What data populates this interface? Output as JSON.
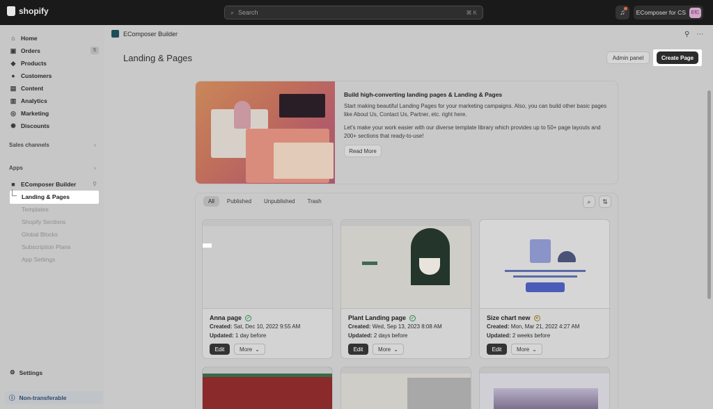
{
  "topbar": {
    "brand": "shopify",
    "search_placeholder": "Search",
    "search_shortcut": "⌘ K",
    "store_name": "EComposer for CS",
    "avatar_initials": "EfC"
  },
  "sidebar": {
    "items": [
      {
        "label": "Home",
        "icon": "home-icon"
      },
      {
        "label": "Orders",
        "icon": "orders-icon",
        "badge": "5"
      },
      {
        "label": "Products",
        "icon": "tag-icon"
      },
      {
        "label": "Customers",
        "icon": "person-icon"
      },
      {
        "label": "Content",
        "icon": "content-icon"
      },
      {
        "label": "Analytics",
        "icon": "chart-icon"
      },
      {
        "label": "Marketing",
        "icon": "target-icon"
      },
      {
        "label": "Discounts",
        "icon": "discount-icon"
      }
    ],
    "sales_channels": "Sales channels",
    "apps": "Apps",
    "app_name": "EComposer Builder",
    "app_subitems": [
      "Landing & Pages",
      "Templates",
      "Shopify Sections",
      "Global Blocks",
      "Subscription Plans",
      "App Settings"
    ],
    "settings": "Settings",
    "non_transferable": "Non-transferable"
  },
  "appbar": {
    "title": "EComposer Builder"
  },
  "page": {
    "title": "Landing & Pages",
    "admin_panel": "Admin panel",
    "create_page": "Create Page"
  },
  "banner": {
    "title": "Build high-converting landing pages & Landing & Pages",
    "text1": "Start making beautiful Landing Pages for your marketing campaigns. Also, you can build other basic pages like About Us, Contact Us, Partner, etc. right here.",
    "text2": "Let's make your work easier with our diverse template library which provides up to 50+ page layouts and 200+ sections that ready-to-use!",
    "read_more": "Read More"
  },
  "tabs": [
    "All",
    "Published",
    "Unpublished",
    "Trash"
  ],
  "cards": [
    {
      "title": "Anna page",
      "status": "published",
      "created_label": "Created:",
      "created": "Sat, Dec 10, 2022 9:55 AM",
      "updated_label": "Updated:",
      "updated": "1 day before",
      "edit": "Edit",
      "more": "More"
    },
    {
      "title": "Plant Landing page",
      "status": "published",
      "created_label": "Created:",
      "created": "Wed, Sep 13, 2023 8:08 AM",
      "updated_label": "Updated:",
      "updated": "2 days before",
      "edit": "Edit",
      "more": "More"
    },
    {
      "title": "Size chart new",
      "status": "unpublished",
      "created_label": "Created:",
      "created": "Mon, Mar 21, 2022 4:27 AM",
      "updated_label": "Updated:",
      "updated": "2 weeks before",
      "edit": "Edit",
      "more": "More"
    }
  ],
  "colors": {
    "accent": "#2c2c2c",
    "highlight": "#ffffff",
    "ok": "#2f8a4a"
  }
}
